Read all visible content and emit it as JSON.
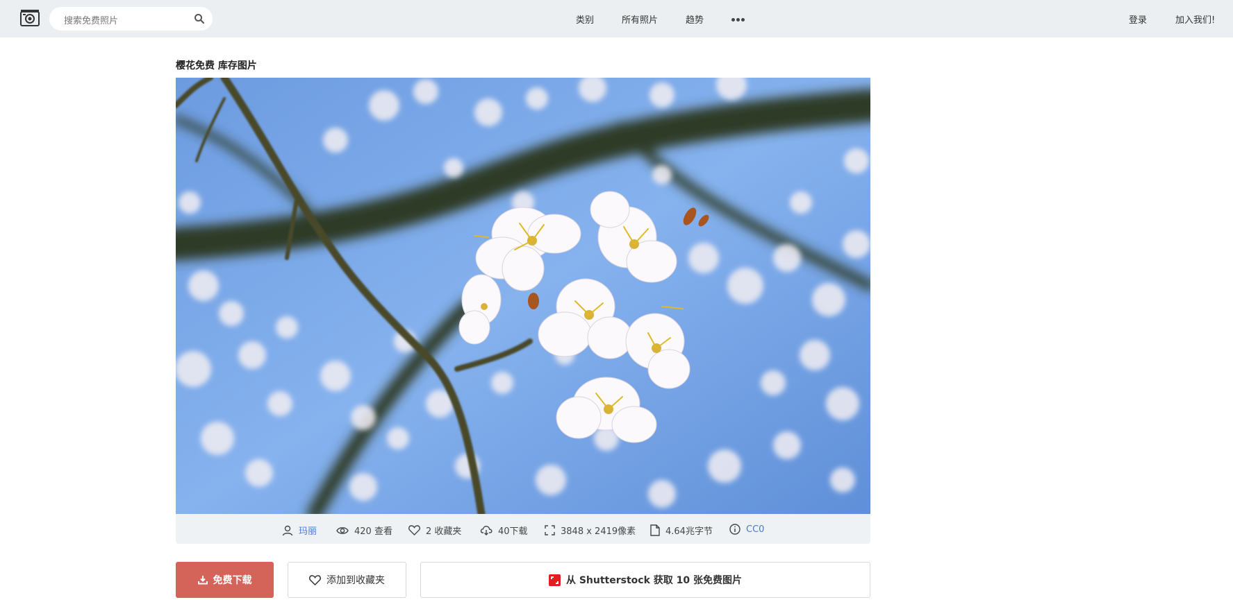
{
  "header": {
    "search_placeholder": "搜索免费照片",
    "nav": [
      "类别",
      "所有照片",
      "趋势"
    ],
    "login": "登录",
    "join": "加入我们!"
  },
  "photo": {
    "title": "樱花免费 库存图片"
  },
  "meta": {
    "author": "玛丽",
    "views": "420 查看",
    "favorites": "2 收藏夹",
    "downloads": "40下载",
    "dimensions": "3848 x 2419像素",
    "file_size": "4.64兆字节",
    "license": "CC0"
  },
  "actions": {
    "download": "免费下载",
    "add_favorite": "添加到收藏夹",
    "shutterstock": "从 Shutterstock 获取 10 张免费图片"
  },
  "colors": {
    "topbar": "#eceff2",
    "download_button": "#d4645a",
    "link": "#4a79c7",
    "sky": "#7aa6e6",
    "shutterstock_logo": "#e02020"
  }
}
